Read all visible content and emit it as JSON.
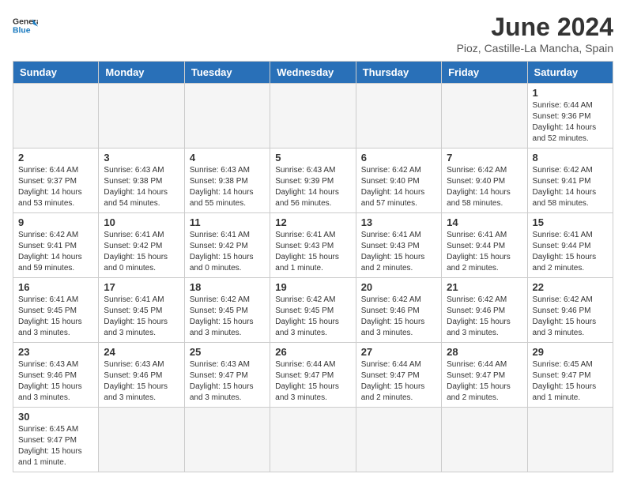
{
  "header": {
    "logo_general": "General",
    "logo_blue": "Blue",
    "title": "June 2024",
    "location": "Pioz, Castille-La Mancha, Spain"
  },
  "days_of_week": [
    "Sunday",
    "Monday",
    "Tuesday",
    "Wednesday",
    "Thursday",
    "Friday",
    "Saturday"
  ],
  "weeks": [
    [
      {
        "day": "",
        "info": ""
      },
      {
        "day": "",
        "info": ""
      },
      {
        "day": "",
        "info": ""
      },
      {
        "day": "",
        "info": ""
      },
      {
        "day": "",
        "info": ""
      },
      {
        "day": "",
        "info": ""
      },
      {
        "day": "1",
        "info": "Sunrise: 6:44 AM\nSunset: 9:36 PM\nDaylight: 14 hours and 52 minutes."
      }
    ],
    [
      {
        "day": "2",
        "info": "Sunrise: 6:44 AM\nSunset: 9:37 PM\nDaylight: 14 hours and 53 minutes."
      },
      {
        "day": "3",
        "info": "Sunrise: 6:43 AM\nSunset: 9:38 PM\nDaylight: 14 hours and 54 minutes."
      },
      {
        "day": "4",
        "info": "Sunrise: 6:43 AM\nSunset: 9:38 PM\nDaylight: 14 hours and 55 minutes."
      },
      {
        "day": "5",
        "info": "Sunrise: 6:43 AM\nSunset: 9:39 PM\nDaylight: 14 hours and 56 minutes."
      },
      {
        "day": "6",
        "info": "Sunrise: 6:42 AM\nSunset: 9:40 PM\nDaylight: 14 hours and 57 minutes."
      },
      {
        "day": "7",
        "info": "Sunrise: 6:42 AM\nSunset: 9:40 PM\nDaylight: 14 hours and 58 minutes."
      },
      {
        "day": "8",
        "info": "Sunrise: 6:42 AM\nSunset: 9:41 PM\nDaylight: 14 hours and 58 minutes."
      }
    ],
    [
      {
        "day": "9",
        "info": "Sunrise: 6:42 AM\nSunset: 9:41 PM\nDaylight: 14 hours and 59 minutes."
      },
      {
        "day": "10",
        "info": "Sunrise: 6:41 AM\nSunset: 9:42 PM\nDaylight: 15 hours and 0 minutes."
      },
      {
        "day": "11",
        "info": "Sunrise: 6:41 AM\nSunset: 9:42 PM\nDaylight: 15 hours and 0 minutes."
      },
      {
        "day": "12",
        "info": "Sunrise: 6:41 AM\nSunset: 9:43 PM\nDaylight: 15 hours and 1 minute."
      },
      {
        "day": "13",
        "info": "Sunrise: 6:41 AM\nSunset: 9:43 PM\nDaylight: 15 hours and 2 minutes."
      },
      {
        "day": "14",
        "info": "Sunrise: 6:41 AM\nSunset: 9:44 PM\nDaylight: 15 hours and 2 minutes."
      },
      {
        "day": "15",
        "info": "Sunrise: 6:41 AM\nSunset: 9:44 PM\nDaylight: 15 hours and 2 minutes."
      }
    ],
    [
      {
        "day": "16",
        "info": "Sunrise: 6:41 AM\nSunset: 9:45 PM\nDaylight: 15 hours and 3 minutes."
      },
      {
        "day": "17",
        "info": "Sunrise: 6:41 AM\nSunset: 9:45 PM\nDaylight: 15 hours and 3 minutes."
      },
      {
        "day": "18",
        "info": "Sunrise: 6:42 AM\nSunset: 9:45 PM\nDaylight: 15 hours and 3 minutes."
      },
      {
        "day": "19",
        "info": "Sunrise: 6:42 AM\nSunset: 9:45 PM\nDaylight: 15 hours and 3 minutes."
      },
      {
        "day": "20",
        "info": "Sunrise: 6:42 AM\nSunset: 9:46 PM\nDaylight: 15 hours and 3 minutes."
      },
      {
        "day": "21",
        "info": "Sunrise: 6:42 AM\nSunset: 9:46 PM\nDaylight: 15 hours and 3 minutes."
      },
      {
        "day": "22",
        "info": "Sunrise: 6:42 AM\nSunset: 9:46 PM\nDaylight: 15 hours and 3 minutes."
      }
    ],
    [
      {
        "day": "23",
        "info": "Sunrise: 6:43 AM\nSunset: 9:46 PM\nDaylight: 15 hours and 3 minutes."
      },
      {
        "day": "24",
        "info": "Sunrise: 6:43 AM\nSunset: 9:46 PM\nDaylight: 15 hours and 3 minutes."
      },
      {
        "day": "25",
        "info": "Sunrise: 6:43 AM\nSunset: 9:47 PM\nDaylight: 15 hours and 3 minutes."
      },
      {
        "day": "26",
        "info": "Sunrise: 6:44 AM\nSunset: 9:47 PM\nDaylight: 15 hours and 3 minutes."
      },
      {
        "day": "27",
        "info": "Sunrise: 6:44 AM\nSunset: 9:47 PM\nDaylight: 15 hours and 2 minutes."
      },
      {
        "day": "28",
        "info": "Sunrise: 6:44 AM\nSunset: 9:47 PM\nDaylight: 15 hours and 2 minutes."
      },
      {
        "day": "29",
        "info": "Sunrise: 6:45 AM\nSunset: 9:47 PM\nDaylight: 15 hours and 1 minute."
      }
    ],
    [
      {
        "day": "30",
        "info": "Sunrise: 6:45 AM\nSunset: 9:47 PM\nDaylight: 15 hours and 1 minute."
      },
      {
        "day": "",
        "info": ""
      },
      {
        "day": "",
        "info": ""
      },
      {
        "day": "",
        "info": ""
      },
      {
        "day": "",
        "info": ""
      },
      {
        "day": "",
        "info": ""
      },
      {
        "day": "",
        "info": ""
      }
    ]
  ]
}
